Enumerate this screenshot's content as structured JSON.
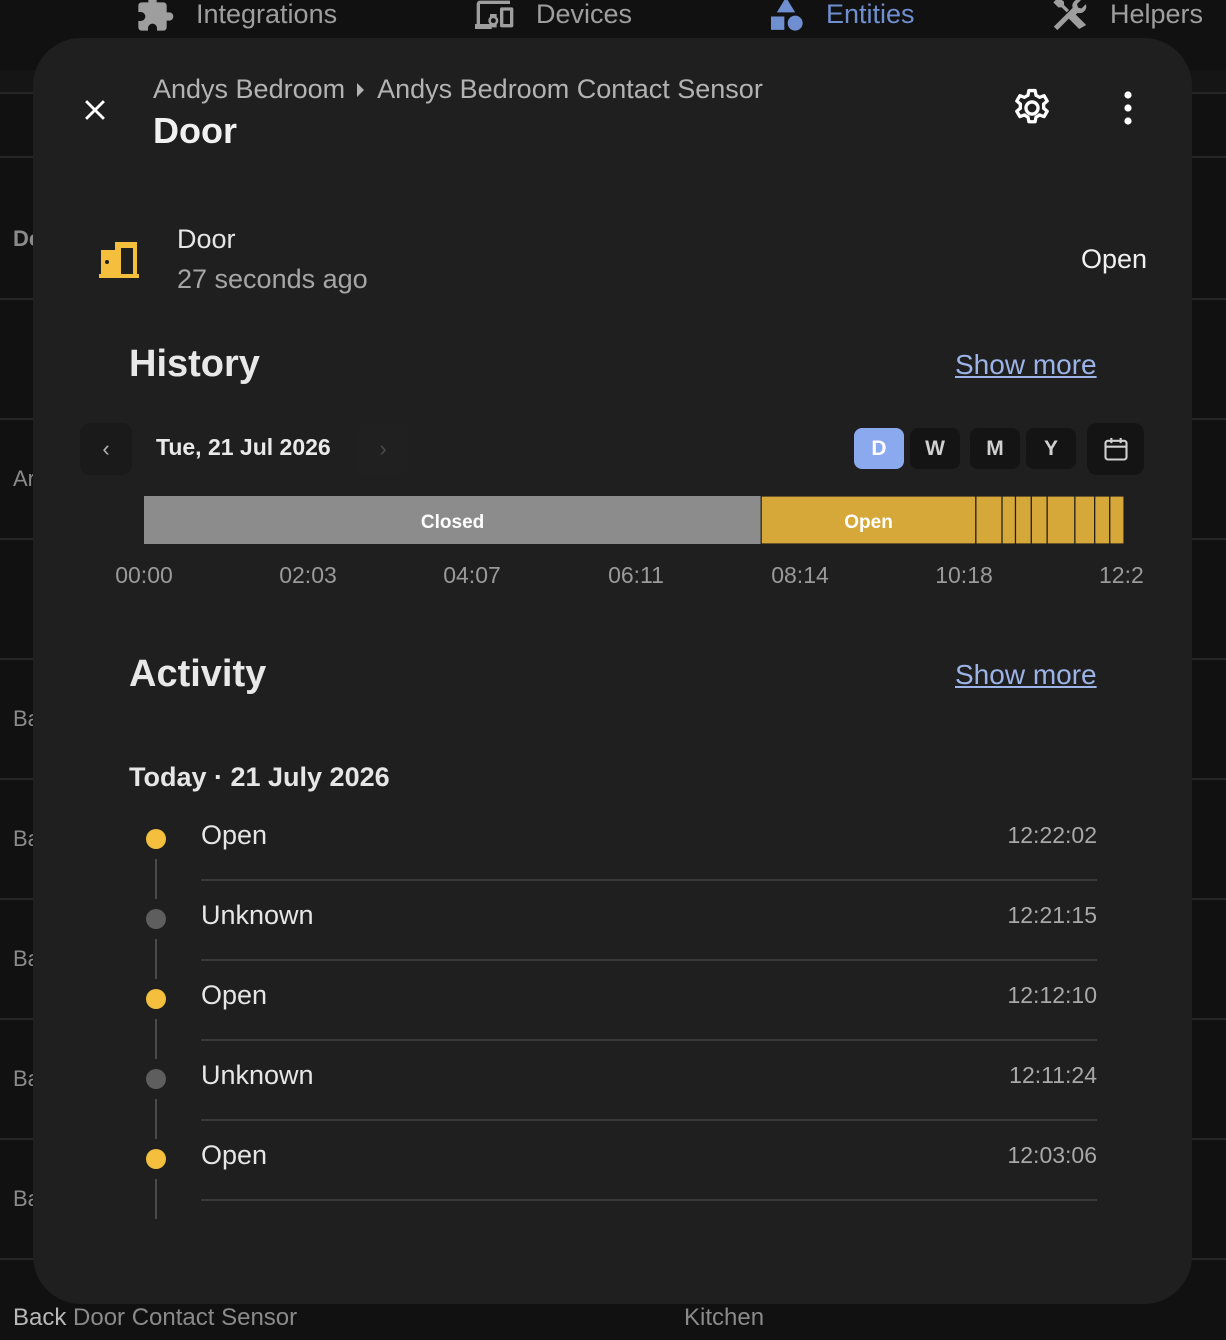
{
  "nav": {
    "tabs": [
      {
        "label": "Integrations",
        "icon": "puzzle-icon",
        "active": false
      },
      {
        "label": "Devices",
        "icon": "devices-icon",
        "active": false
      },
      {
        "label": "Entities",
        "icon": "shapes-icon",
        "active": true
      },
      {
        "label": "Helpers",
        "icon": "tools-icon",
        "active": false
      }
    ]
  },
  "background": {
    "row_labels": [
      "De",
      "Ar",
      "Ba",
      "Ba",
      "Ba",
      "Ba",
      "Ba"
    ],
    "bottom_row": {
      "name_bold": "Back",
      "name_rest": " Door Contact Sensor",
      "area": "Kitchen"
    }
  },
  "dialog": {
    "breadcrumb": {
      "area": "Andys Bedroom",
      "device": "Andys Bedroom Contact Sensor"
    },
    "title": "Door",
    "entity": {
      "name": "Door",
      "last_changed": "27 seconds ago",
      "state": "Open",
      "icon": "door-open-icon"
    },
    "history": {
      "title": "History",
      "show_more": "Show more",
      "date": "Tue, 21 Jul 2026",
      "prev": "‹",
      "next": "›",
      "ranges": [
        {
          "label": "D",
          "active": true
        },
        {
          "label": "W",
          "active": false
        },
        {
          "label": "M",
          "active": false
        },
        {
          "label": "Y",
          "active": false
        }
      ]
    },
    "activity": {
      "title": "Activity",
      "show_more": "Show more",
      "date_heading": "Today · 21 July 2026",
      "items": [
        {
          "state": "Open",
          "time": "12:22:02",
          "kind": "open"
        },
        {
          "state": "Unknown",
          "time": "12:21:15",
          "kind": "unknown"
        },
        {
          "state": "Open",
          "time": "12:12:10",
          "kind": "open"
        },
        {
          "state": "Unknown",
          "time": "12:11:24",
          "kind": "unknown"
        },
        {
          "state": "Open",
          "time": "12:03:06",
          "kind": "open"
        }
      ]
    }
  },
  "colors": {
    "open": "#d6a83a",
    "closed": "#8c8c8c",
    "dot_open": "#f4bf3c",
    "dot_unknown": "#5e5e5e",
    "accent": "#8aa9ee",
    "link": "#9cb3e8"
  },
  "chart_data": {
    "type": "timeline",
    "x_tick_labels": [
      "00:00",
      "02:03",
      "04:07",
      "06:11",
      "08:14",
      "10:18",
      "12:2"
    ],
    "x_range_hours": [
      0,
      12.42
    ],
    "segments": [
      {
        "state": "Closed",
        "start": 0.0,
        "end": 7.79,
        "label": "Closed"
      },
      {
        "state": "Open",
        "start": 7.79,
        "end": 10.5,
        "label": "Open"
      },
      {
        "state": "Open",
        "start": 10.5,
        "end": 10.83
      },
      {
        "state": "Open",
        "start": 10.83,
        "end": 11.0
      },
      {
        "state": "Open",
        "start": 11.0,
        "end": 11.2
      },
      {
        "state": "Open",
        "start": 11.2,
        "end": 11.4
      },
      {
        "state": "Open",
        "start": 11.4,
        "end": 11.75
      },
      {
        "state": "Open",
        "start": 11.75,
        "end": 12.0
      },
      {
        "state": "Open",
        "start": 12.0,
        "end": 12.19
      },
      {
        "state": "Open",
        "start": 12.19,
        "end": 12.37
      }
    ]
  }
}
